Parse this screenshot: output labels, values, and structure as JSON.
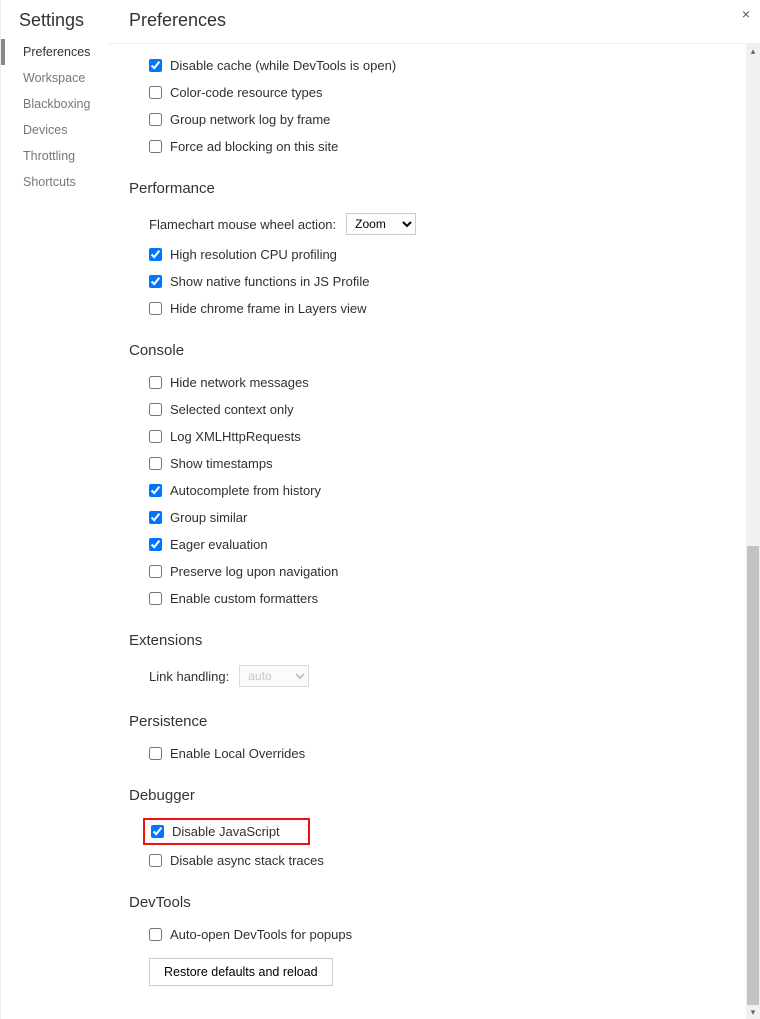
{
  "close_glyph": "×",
  "sidebar": {
    "title": "Settings",
    "items": [
      "Preferences",
      "Workspace",
      "Blackboxing",
      "Devices",
      "Throttling",
      "Shortcuts"
    ],
    "active_index": 0
  },
  "main": {
    "title": "Preferences"
  },
  "network_top": [
    {
      "label": "Disable cache (while DevTools is open)",
      "checked": true
    },
    {
      "label": "Color-code resource types",
      "checked": false
    },
    {
      "label": "Group network log by frame",
      "checked": false
    },
    {
      "label": "Force ad blocking on this site",
      "checked": false
    }
  ],
  "sections": {
    "performance": {
      "title": "Performance",
      "select_label": "Flamechart mouse wheel action:",
      "select_value": "Zoom",
      "items": [
        {
          "label": "High resolution CPU profiling",
          "checked": true
        },
        {
          "label": "Show native functions in JS Profile",
          "checked": true
        },
        {
          "label": "Hide chrome frame in Layers view",
          "checked": false
        }
      ]
    },
    "console": {
      "title": "Console",
      "items": [
        {
          "label": "Hide network messages",
          "checked": false
        },
        {
          "label": "Selected context only",
          "checked": false
        },
        {
          "label": "Log XMLHttpRequests",
          "checked": false
        },
        {
          "label": "Show timestamps",
          "checked": false
        },
        {
          "label": "Autocomplete from history",
          "checked": true
        },
        {
          "label": "Group similar",
          "checked": true
        },
        {
          "label": "Eager evaluation",
          "checked": true
        },
        {
          "label": "Preserve log upon navigation",
          "checked": false
        },
        {
          "label": "Enable custom formatters",
          "checked": false
        }
      ]
    },
    "extensions": {
      "title": "Extensions",
      "select_label": "Link handling:",
      "select_value": "auto"
    },
    "persistence": {
      "title": "Persistence",
      "items": [
        {
          "label": "Enable Local Overrides",
          "checked": false
        }
      ]
    },
    "debugger": {
      "title": "Debugger",
      "highlighted": {
        "label": "Disable JavaScript",
        "checked": true
      },
      "items": [
        {
          "label": "Disable async stack traces",
          "checked": false
        }
      ]
    },
    "devtools": {
      "title": "DevTools",
      "items": [
        {
          "label": "Auto-open DevTools for popups",
          "checked": false
        }
      ]
    }
  },
  "restore_button": "Restore defaults and reload"
}
